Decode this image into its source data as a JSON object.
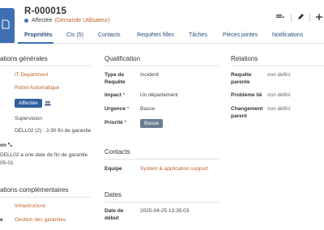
{
  "header": {
    "record_id": "R-000015",
    "status": "Affectée",
    "status_detail": "(Demande Utilisateur)",
    "menu_icon": "menu-icon",
    "edit_icon": "pencil-icon",
    "add_icon": "plus-icon"
  },
  "tabs": [
    {
      "label": "Propriétés"
    },
    {
      "label": "CIs (5)"
    },
    {
      "label": "Contacts"
    },
    {
      "label": "Requêtes filles"
    },
    {
      "label": "Tâches"
    },
    {
      "label": "Pièces jointes"
    },
    {
      "label": "Notifications"
    }
  ],
  "general": {
    "title": "ations générales",
    "org": "IT Department",
    "service": "Robot Automatique",
    "status_badge": "Affectée",
    "team": "Supervision",
    "sla": "DELL02 (2) : J-30 fin de garantie",
    "desc_label": "on",
    "desc_line1": "DELL02 a une date de fin de garantie",
    "desc_line2": "05-01"
  },
  "complementary": {
    "title": "ations complémentaires",
    "category": "Infrastructure",
    "subcategory": "Gestion des garanties",
    "side_label": "e"
  },
  "qualification": {
    "title": "Qualification",
    "type_label_1": "Type de",
    "type_label_2": "Requête",
    "type_value": "Incident",
    "impact_label": "Impact",
    "impact_value": "Un département",
    "urgency_label": "Urgence",
    "urgency_value": "Basse",
    "priority_label": "Priorité",
    "priority_value": "Basse"
  },
  "contacts": {
    "title": "Contacts",
    "team_label": "Equipe",
    "team_value": "System & application support"
  },
  "dates": {
    "title": "Dates",
    "start_label_1": "Date de",
    "start_label_2": "début",
    "start_value": "2025-04-25 13:35:03"
  },
  "relations": {
    "title": "Relations",
    "parent_label_1": "Requête",
    "parent_label_2": "parente",
    "parent_value": "non defini",
    "problem_label": "Problème lié",
    "problem_value": "non defini",
    "change_label_1": "Changement",
    "change_label_2": "parent",
    "change_value": "non defini"
  },
  "required_mark": "*",
  "colors": {
    "accent": "#3e6fb3",
    "link": "#c2622b",
    "badge": "#2f5f9e"
  }
}
